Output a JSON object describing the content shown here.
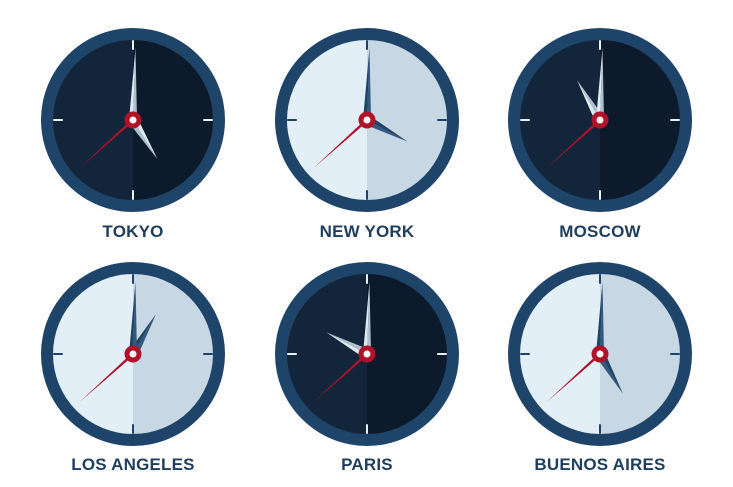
{
  "palette": {
    "rim": "#1f4469",
    "dark_face_left": "#13253b",
    "dark_face_right": "#0c1a2b",
    "light_face_left": "#e3eff7",
    "light_face_right": "#c7d7e4",
    "hand_dark_face": "#dfe9f0",
    "hand_dark_face_shade": "#aebfcd",
    "hand_light_face": "#1f4469",
    "hand_light_face_shade": "#33597f",
    "second_hand": "#b0122a",
    "hub": "#b0122a",
    "hub_inner": "#ffffff",
    "label": "#1f3e5e"
  },
  "clocks": [
    {
      "city": "TOKYO",
      "face": "dark",
      "hour_angle": 148,
      "minute_angle": 2,
      "second_angle": 228
    },
    {
      "city": "NEW YORK",
      "face": "light",
      "hour_angle": 118,
      "minute_angle": 2,
      "second_angle": 228
    },
    {
      "city": "MOSCOW",
      "face": "dark",
      "hour_angle": 330,
      "minute_angle": 2,
      "second_angle": 228
    },
    {
      "city": "LOS ANGELES",
      "face": "light",
      "hour_angle": 30,
      "minute_angle": 2,
      "second_angle": 228
    },
    {
      "city": "PARIS",
      "face": "dark",
      "hour_angle": 298,
      "minute_angle": 2,
      "second_angle": 228
    },
    {
      "city": "BUENOS AIRES",
      "face": "light",
      "hour_angle": 150,
      "minute_angle": 2,
      "second_angle": 228
    }
  ]
}
